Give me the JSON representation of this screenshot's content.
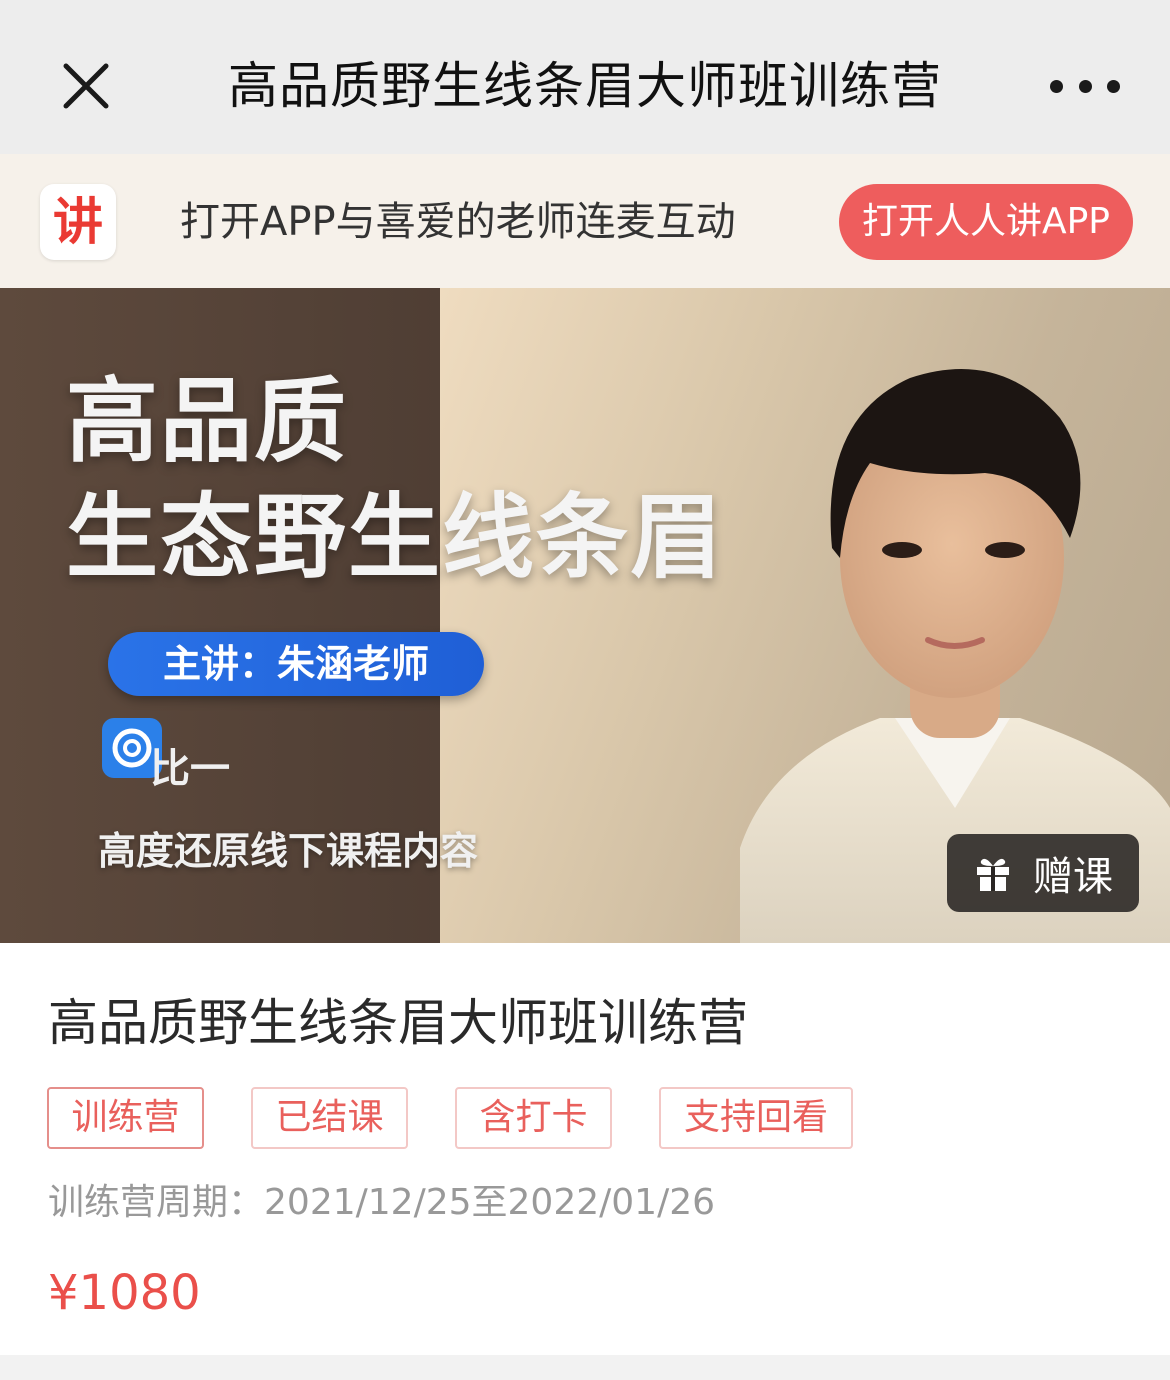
{
  "nav": {
    "title": "高品质野生线条眉大师班训练营"
  },
  "banner": {
    "logo_char": "讲",
    "text": "打开APP与喜爱的老师连麦互动",
    "button_label": "打开人人讲APP",
    "accent": "#ee5d5d"
  },
  "cover": {
    "title_line1": "高品质",
    "title_line2": "生态野生线条眉",
    "presenter": "主讲：朱涵老师",
    "ratio_text": "比一",
    "subtitle": "高度还原线下课程内容",
    "gift_label": "赠课"
  },
  "course": {
    "title": "高品质野生线条眉大师班训练营",
    "tags": [
      "训练营",
      "已结课",
      "含打卡",
      "支持回看"
    ],
    "period_label": "训练营周期：",
    "period_value": "2021/12/25至2022/01/26",
    "price": "¥1080",
    "price_color": "#ea4f4a"
  }
}
